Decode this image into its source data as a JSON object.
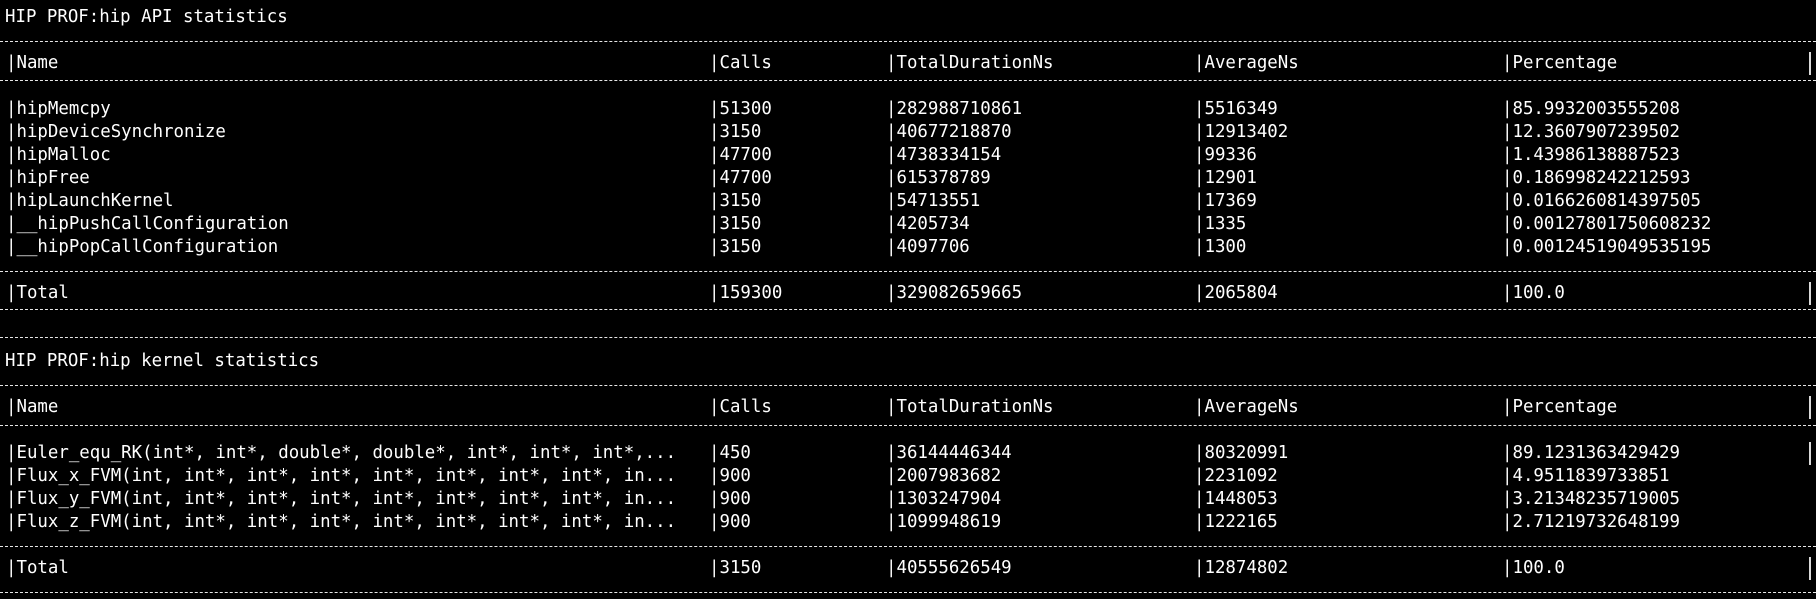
{
  "api": {
    "title": "HIP PROF:hip API statistics",
    "headers": [
      "|Name",
      "|Calls",
      "|TotalDurationNs",
      "|AverageNs",
      "|Percentage"
    ],
    "rows": [
      [
        "|hipMemcpy",
        "|51300",
        "|282988710861",
        "|5516349",
        "|85.9932003555208"
      ],
      [
        "|hipDeviceSynchronize",
        "|3150",
        "|40677218870",
        "|12913402",
        "|12.3607907239502"
      ],
      [
        "|hipMalloc",
        "|47700",
        "|4738334154",
        "|99336",
        "|1.43986138887523"
      ],
      [
        "|hipFree",
        "|47700",
        "|615378789",
        "|12901",
        "|0.186998242212593"
      ],
      [
        "|hipLaunchKernel",
        "|3150",
        "|54713551",
        "|17369",
        "|0.0166260814397505"
      ],
      [
        "|__hipPushCallConfiguration",
        "|3150",
        "|4205734",
        "|1335",
        "|0.00127801750608232"
      ],
      [
        "|__hipPopCallConfiguration",
        "|3150",
        "|4097706",
        "|1300",
        "|0.00124519049535195"
      ]
    ],
    "total": [
      "|Total",
      "|159300",
      "|329082659665",
      "|2065804",
      "|100.0"
    ]
  },
  "kernel": {
    "title": "HIP PROF:hip kernel statistics",
    "headers": [
      "|Name",
      "|Calls",
      "|TotalDurationNs",
      "|AverageNs",
      "|Percentage"
    ],
    "rows": [
      [
        "|Euler_equ_RK(int*, int*, double*, double*, int*, int*, int*,...",
        "|450",
        "|36144446344",
        "|80320991",
        "|89.1231363429429"
      ],
      [
        "|Flux_x_FVM(int, int*, int*, int*, int*, int*, int*, int*, in...",
        "|900",
        "|2007983682",
        "|2231092",
        "|4.9511839733851"
      ],
      [
        "|Flux_y_FVM(int, int*, int*, int*, int*, int*, int*, int*, in...",
        "|900",
        "|1303247904",
        "|1448053",
        "|3.21348235719005"
      ],
      [
        "|Flux_z_FVM(int, int*, int*, int*, int*, int*, int*, int*, in...",
        "|900",
        "|1099948619",
        "|1222165",
        "|2.71219732648199"
      ]
    ],
    "total": [
      "|Total",
      "|3150",
      "|40555626549",
      "|12874802",
      "|100.0"
    ]
  }
}
